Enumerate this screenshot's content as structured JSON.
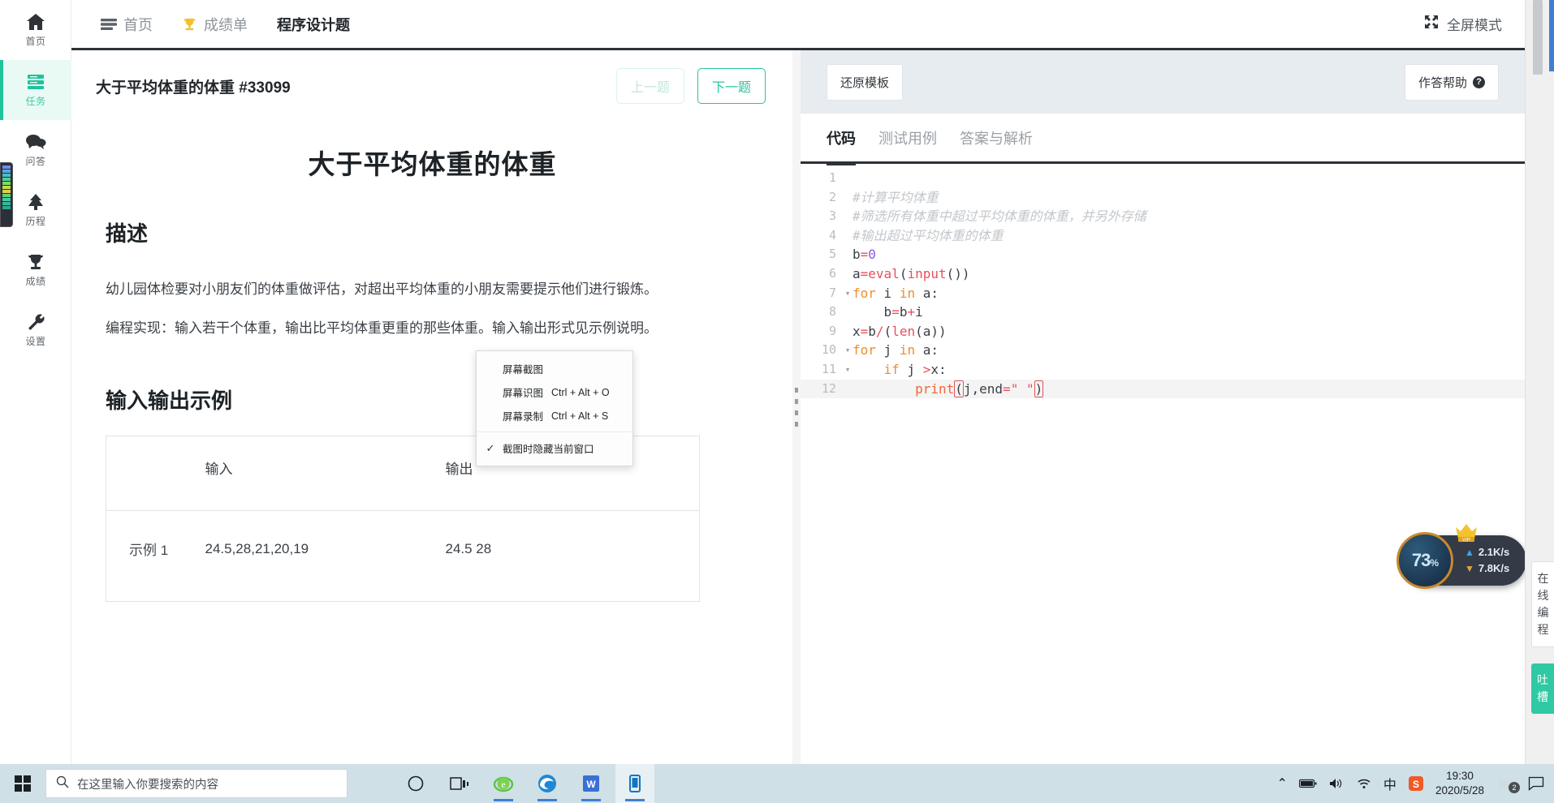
{
  "sidebar": {
    "items": [
      {
        "label": "首页",
        "icon": "home-icon",
        "active": false
      },
      {
        "label": "任务",
        "icon": "tasks-icon",
        "active": true
      },
      {
        "label": "问答",
        "icon": "chat-icon",
        "active": false
      },
      {
        "label": "历程",
        "icon": "tree-icon",
        "active": false
      },
      {
        "label": "成绩",
        "icon": "trophy-icon",
        "active": false
      },
      {
        "label": "设置",
        "icon": "wrench-icon",
        "active": false
      }
    ]
  },
  "topbar": {
    "tabs": [
      {
        "label": "首页",
        "icon": "menu-icon",
        "active": false
      },
      {
        "label": "成绩单",
        "icon": "trophy-icon",
        "active": false
      },
      {
        "label": "程序设计题",
        "icon": "",
        "active": true
      }
    ],
    "fullscreen_label": "全屏模式"
  },
  "problem": {
    "header_title": "大于平均体重的体重",
    "header_id": "#33099",
    "prev_label": "上一题",
    "next_label": "下一题",
    "title": "大于平均体重的体重",
    "section_desc": "描述",
    "desc_p1": "幼儿园体检要对小朋友们的体重做评估，对超出平均体重的小朋友需要提示他们进行锻炼。",
    "desc_p2": "编程实现：输入若干个体重，输出比平均体重更重的那些体重。输入输出形式见示例说明。",
    "section_io": "输入输出示例",
    "table": {
      "headers": [
        "",
        "输入",
        "输出"
      ],
      "rows": [
        [
          "示例 1",
          "24.5,28,21,20,19",
          "24.5 28"
        ]
      ]
    }
  },
  "editor": {
    "restore_label": "还原模板",
    "help_label": "作答帮助",
    "help_badge": "?",
    "tabs": [
      {
        "label": "代码",
        "active": true
      },
      {
        "label": "测试用例",
        "active": false
      },
      {
        "label": "答案与解析",
        "active": false
      }
    ],
    "lines": [
      {
        "n": "1",
        "fold": "",
        "text": ""
      },
      {
        "n": "2",
        "fold": "",
        "text": "#计算平均体重"
      },
      {
        "n": "3",
        "fold": "",
        "text": "#筛选所有体重中超过平均体重的体重，并另外存储"
      },
      {
        "n": "4",
        "fold": "",
        "text": "#输出超过平均体重的体重"
      },
      {
        "n": "5",
        "fold": "",
        "text": "b=0"
      },
      {
        "n": "6",
        "fold": "",
        "text": "a=eval(input())"
      },
      {
        "n": "7",
        "fold": "▾",
        "text": "for i in a:"
      },
      {
        "n": "8",
        "fold": "",
        "text": "    b=b+i"
      },
      {
        "n": "9",
        "fold": "",
        "text": "x=b/(len(a))"
      },
      {
        "n": "10",
        "fold": "▾",
        "text": "for j in a:"
      },
      {
        "n": "11",
        "fold": "▾",
        "text": "    if j >x:"
      },
      {
        "n": "12",
        "fold": "",
        "text": "        print(j,end=\" \")"
      }
    ]
  },
  "context_menu": {
    "items": [
      {
        "label": "屏幕截图",
        "shortcut": "",
        "checked": false
      },
      {
        "label": "屏幕识图",
        "shortcut": "Ctrl + Alt + O",
        "checked": false
      },
      {
        "label": "屏幕录制",
        "shortcut": "Ctrl + Alt + S",
        "checked": false
      },
      {
        "label": "截图时隐藏当前窗口",
        "shortcut": "",
        "checked": true
      }
    ],
    "check_glyph": "✓"
  },
  "download_widget": {
    "percent": "73",
    "percent_unit": "%",
    "up_speed": "2.1K/s",
    "down_speed": "7.8K/s",
    "badge": "VIP"
  },
  "right_strip": {
    "online_label": "在线编程",
    "feedback_label": "吐槽"
  },
  "taskbar": {
    "search_placeholder": "在这里输入你要搜索的内容",
    "apps": [
      {
        "name": "cortana-icon",
        "glyph": "◯"
      },
      {
        "name": "task-view-icon",
        "glyph": "❑"
      },
      {
        "name": "ie-old-icon",
        "glyph": "e"
      },
      {
        "name": "edge-icon",
        "glyph": "e"
      },
      {
        "name": "wps-writer-icon",
        "glyph": "W"
      },
      {
        "name": "phone-link-icon",
        "glyph": "▯"
      }
    ],
    "tray": {
      "chevron": "⌃",
      "battery": "battery-icon",
      "volume": "volume-icon",
      "wifi": "wifi-icon",
      "ime": "中",
      "sogou": "S",
      "time": "19:30",
      "date": "2020/5/28",
      "im_badge": "2",
      "notification": "notification-icon"
    }
  },
  "colors": {
    "accent": "#1fc39c",
    "dark": "#2d3238",
    "toolbar_bg": "#e7ecf0",
    "taskbar_bg": "#cfe0e6"
  }
}
